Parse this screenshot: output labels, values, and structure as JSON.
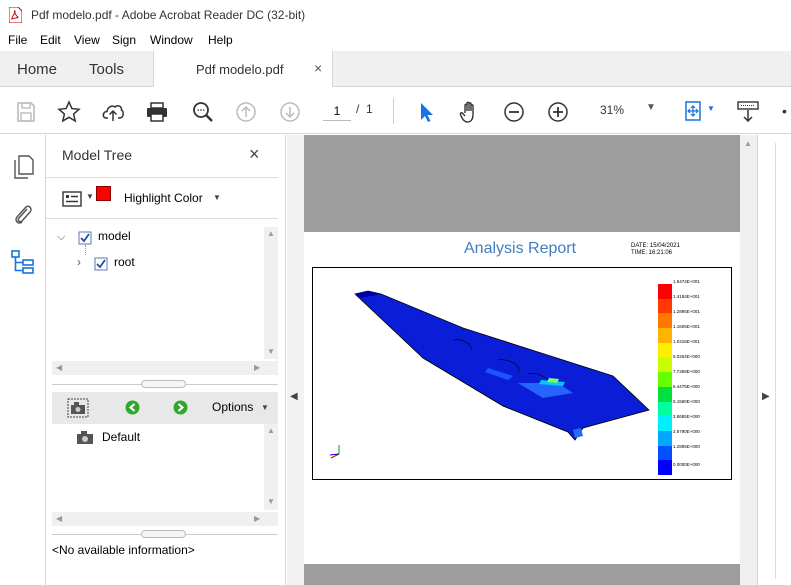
{
  "window": {
    "title": "Pdf modelo.pdf - Adobe Acrobat Reader DC (32-bit)"
  },
  "menu": [
    "File",
    "Edit",
    "View",
    "Sign",
    "Window",
    "Help"
  ],
  "tabs": {
    "home": "Home",
    "tools": "Tools",
    "document": "Pdf modelo.pdf",
    "close_glyph": "×"
  },
  "toolbar": {
    "page_current": "1",
    "page_sep": "/",
    "page_total": "1",
    "zoom": "31%"
  },
  "model_tree": {
    "title": "Model Tree",
    "highlight_label": "Highlight Color",
    "highlight_color": "#ff0000",
    "nodes": [
      {
        "label": "model",
        "checked": true,
        "expanded": true
      },
      {
        "label": "root",
        "checked": true,
        "expanded": false
      }
    ],
    "options_label": "Options",
    "views": [
      "Default"
    ],
    "info": "<No available information>"
  },
  "report": {
    "title": "Analysis Report",
    "date": "DATE: 15/04/2021",
    "time": "TIME: 16:21:06",
    "legend": [
      {
        "label": "1.5474E+001",
        "color": "#ff0000"
      },
      {
        "label": "1.4184E+001",
        "color": "#ff3a00"
      },
      {
        "label": "1.2895E+001",
        "color": "#ff7800"
      },
      {
        "label": "1.1605E+001",
        "color": "#ffb400"
      },
      {
        "label": "1.0316E+001",
        "color": "#ffee00"
      },
      {
        "label": "9.0264E+000",
        "color": "#c8ff00"
      },
      {
        "label": "7.7369E+000",
        "color": "#66ff00"
      },
      {
        "label": "6.4475E+000",
        "color": "#00e040"
      },
      {
        "label": "5.1580E+000",
        "color": "#00ffa0"
      },
      {
        "label": "3.8685E+000",
        "color": "#00f0ff"
      },
      {
        "label": "2.5790E+000",
        "color": "#00a8ff"
      },
      {
        "label": "1.2895E+000",
        "color": "#0050ff"
      },
      {
        "label": "0.0000E+000",
        "color": "#0000ff"
      }
    ]
  }
}
